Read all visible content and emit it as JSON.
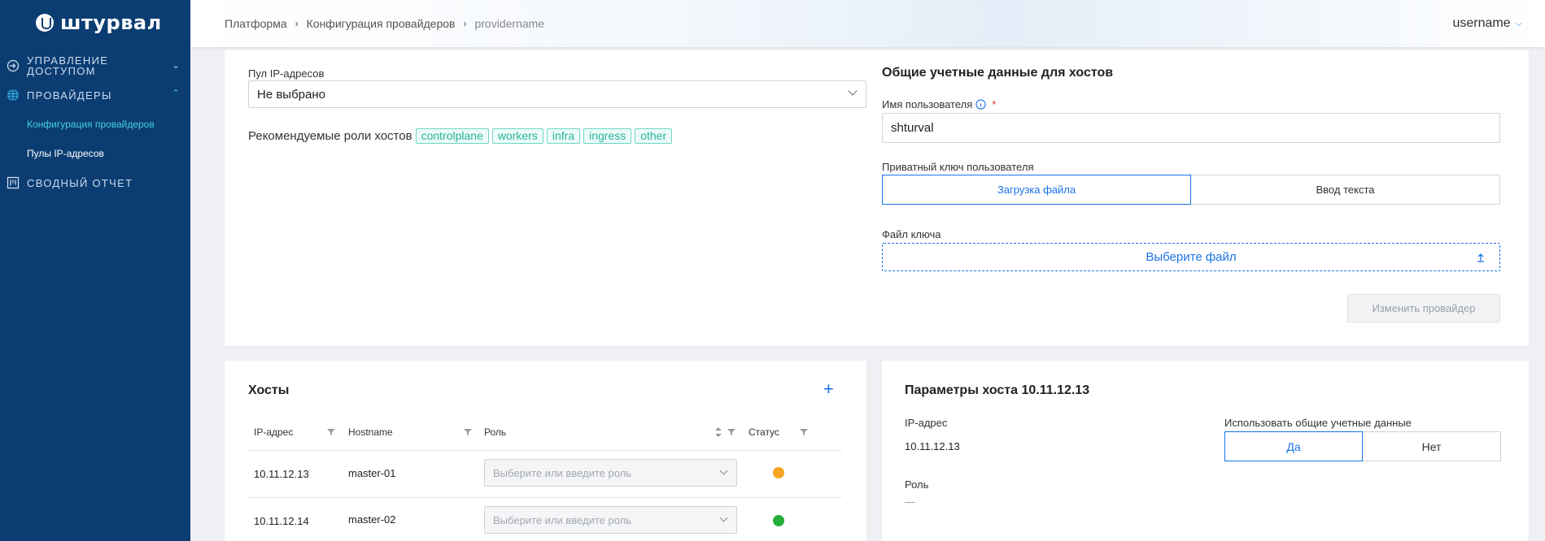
{
  "sidebar": {
    "logo_text": "штурвал",
    "items": [
      {
        "label": "Управление доступом",
        "icon": "login-icon",
        "expanded": false
      },
      {
        "label": "Провайдеры",
        "icon": "globe-icon",
        "expanded": true
      },
      {
        "label": "Сводный отчет",
        "icon": "report-icon",
        "expanded": false
      }
    ],
    "subitems": [
      {
        "label": "Конфигурация провайдеров",
        "active": true
      },
      {
        "label": "Пулы IP-адресов",
        "active": false
      }
    ]
  },
  "header": {
    "breadcrumbs": [
      "Платформа",
      "Конфигурация провайдеров",
      "providername"
    ],
    "username": "username"
  },
  "provider_form": {
    "ip_pool_label": "Пул IP-адресов",
    "ip_pool_value": "Не выбрано",
    "roles_label": "Рекомендуемые роли хостов",
    "roles": [
      "controlplane",
      "workers",
      "infra",
      "ingress",
      "other"
    ],
    "credentials_title": "Общие учетные данные для хостов",
    "username_label": "Имя пользователя",
    "required_mark": "*",
    "username_value": "shturval",
    "private_key_label": "Приватный ключ пользователя",
    "key_options": [
      "Загрузка файла",
      "Ввод текста"
    ],
    "key_selected": 0,
    "key_file_label": "Файл ключа",
    "key_file_button": "Выберите файл",
    "submit_label": "Изменить провайдер"
  },
  "hosts": {
    "title": "Хосты",
    "add_symbol": "+",
    "columns": [
      "IP-адрес",
      "Hostname",
      "Роль",
      "Статус"
    ],
    "role_placeholder": "Выберите или введите роль",
    "rows": [
      {
        "ip": "10.11.12.13",
        "hostname": "master-01",
        "status": "warning"
      },
      {
        "ip": "10.11.12.14",
        "hostname": "master-02",
        "status": "ok"
      }
    ]
  },
  "host_params": {
    "title": "Параметры хоста 10.11.12.13",
    "ip_label": "IP-адрес",
    "ip_value": "10.11.12.13",
    "shared_creds_label": "Использовать общие учетные данные",
    "shared_options": [
      "Да",
      "Нет"
    ],
    "shared_selected": 0,
    "role_label": "Роль",
    "role_value": "—"
  },
  "colors": {
    "sidebar_bg": "#0b3d73",
    "accent": "#1a73e8",
    "tag": "#2ab5a0",
    "status_warning": "#f5a623",
    "status_ok": "#27ae3a"
  }
}
